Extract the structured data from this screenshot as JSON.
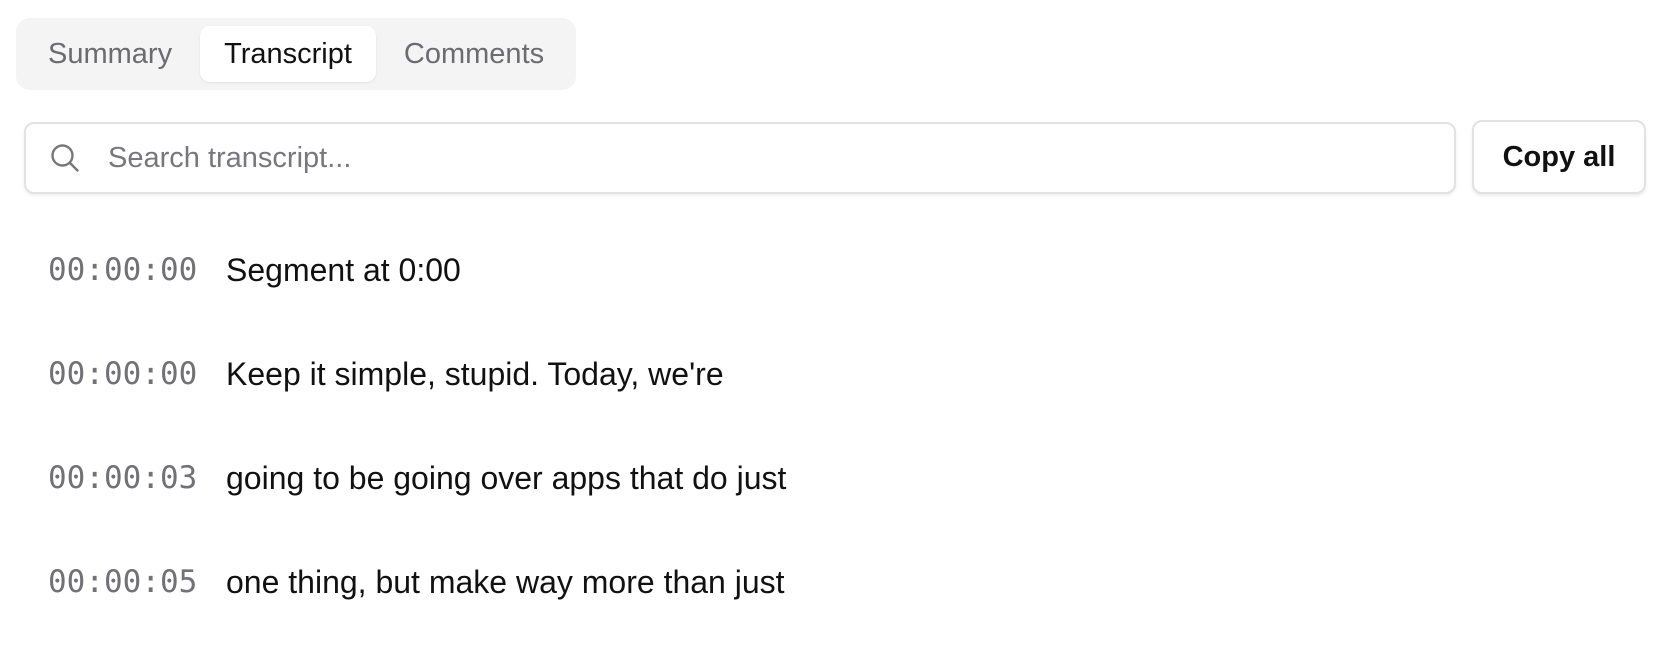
{
  "tabs": [
    {
      "label": "Summary",
      "active": false
    },
    {
      "label": "Transcript",
      "active": true
    },
    {
      "label": "Comments",
      "active": false
    }
  ],
  "search": {
    "placeholder": "Search transcript...",
    "value": "",
    "icon": "search-icon"
  },
  "copy_button": {
    "label": "Copy all"
  },
  "segments": [
    {
      "timestamp": "00:00:00",
      "text": "Segment at 0:00"
    },
    {
      "timestamp": "00:00:00",
      "text": "Keep it simple, stupid. Today, we're"
    },
    {
      "timestamp": "00:00:03",
      "text": "going to be going over apps that do just"
    },
    {
      "timestamp": "00:00:05",
      "text": "one thing, but make way more than just"
    }
  ],
  "colors": {
    "tab_bar_bg": "#f4f4f5",
    "muted_text": "#6b6b70",
    "border": "#e2e2e5"
  }
}
